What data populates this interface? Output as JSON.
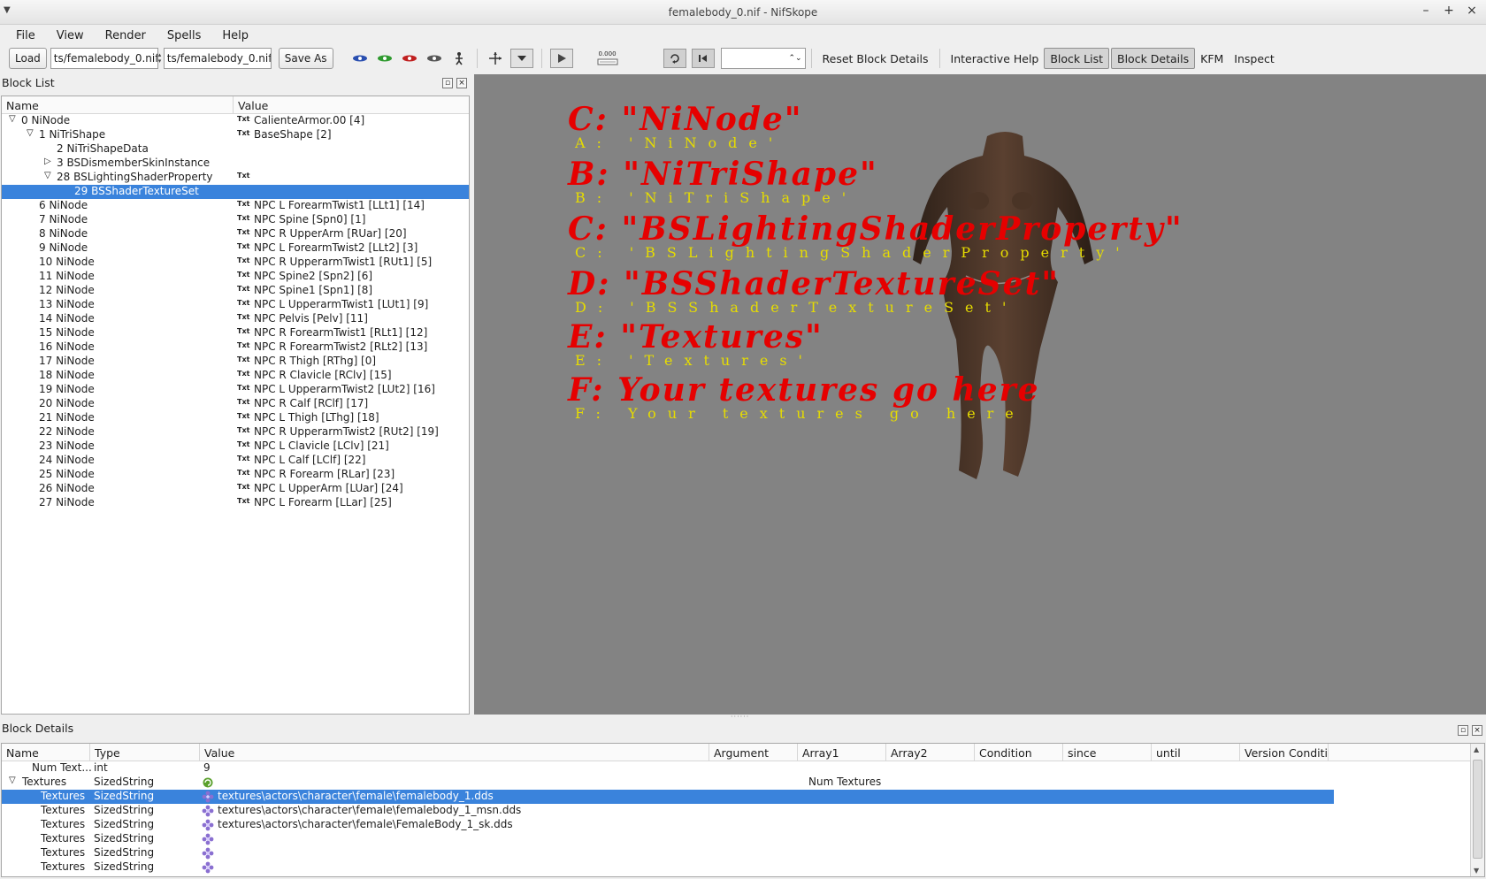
{
  "window": {
    "title": "femalebody_0.nif - NifSkope"
  },
  "menu": [
    {
      "label": "File"
    },
    {
      "label": "View"
    },
    {
      "label": "Render"
    },
    {
      "label": "Spells"
    },
    {
      "label": "Help"
    }
  ],
  "toolbar": {
    "load_label": "Load",
    "load_path": "ts/femalebody_0.nif",
    "save_path": "ts/femalebody_0.nif",
    "save_as_label": "Save As",
    "anim_time": "0.000",
    "reset_block_details": "Reset Block Details",
    "interactive_help": "Interactive Help",
    "block_list": "Block List",
    "block_details": "Block Details",
    "kfm": "KFM",
    "inspect": "Inspect"
  },
  "block_list": {
    "title": "Block List",
    "col_name": "Name",
    "col_value": "Value",
    "rows": [
      {
        "name": "0 NiNode",
        "value": "CalienteArmor.00 [4]",
        "depth": 0,
        "expand": "open",
        "txt": true
      },
      {
        "name": "1 NiTriShape",
        "value": "BaseShape [2]",
        "depth": 1,
        "expand": "open",
        "txt": true
      },
      {
        "name": "2 NiTriShapeData",
        "value": "",
        "depth": 2,
        "expand": "",
        "txt": false
      },
      {
        "name": "3 BSDismemberSkinInstance",
        "value": "",
        "depth": 2,
        "expand": "closed",
        "txt": false
      },
      {
        "name": "28 BSLightingShaderProperty",
        "value": "",
        "depth": 2,
        "expand": "open",
        "txt": true
      },
      {
        "name": "29 BSShaderTextureSet",
        "value": "",
        "depth": 3,
        "expand": "",
        "txt": false,
        "selected": true
      },
      {
        "name": "6 NiNode",
        "value": "NPC L ForearmTwist1 [LLt1] [14]",
        "depth": 1,
        "expand": "",
        "txt": true
      },
      {
        "name": "7 NiNode",
        "value": "NPC Spine [Spn0] [1]",
        "depth": 1,
        "expand": "",
        "txt": true
      },
      {
        "name": "8 NiNode",
        "value": "NPC R UpperArm [RUar] [20]",
        "depth": 1,
        "expand": "",
        "txt": true
      },
      {
        "name": "9 NiNode",
        "value": "NPC L ForearmTwist2 [LLt2] [3]",
        "depth": 1,
        "expand": "",
        "txt": true
      },
      {
        "name": "10 NiNode",
        "value": "NPC R UpperarmTwist1 [RUt1] [5]",
        "depth": 1,
        "expand": "",
        "txt": true
      },
      {
        "name": "11 NiNode",
        "value": "NPC Spine2 [Spn2] [6]",
        "depth": 1,
        "expand": "",
        "txt": true
      },
      {
        "name": "12 NiNode",
        "value": "NPC Spine1 [Spn1] [8]",
        "depth": 1,
        "expand": "",
        "txt": true
      },
      {
        "name": "13 NiNode",
        "value": "NPC L UpperarmTwist1 [LUt1] [9]",
        "depth": 1,
        "expand": "",
        "txt": true
      },
      {
        "name": "14 NiNode",
        "value": "NPC Pelvis [Pelv] [11]",
        "depth": 1,
        "expand": "",
        "txt": true
      },
      {
        "name": "15 NiNode",
        "value": "NPC R ForearmTwist1 [RLt1] [12]",
        "depth": 1,
        "expand": "",
        "txt": true
      },
      {
        "name": "16 NiNode",
        "value": "NPC R ForearmTwist2 [RLt2] [13]",
        "depth": 1,
        "expand": "",
        "txt": true
      },
      {
        "name": "17 NiNode",
        "value": "NPC R Thigh [RThg] [0]",
        "depth": 1,
        "expand": "",
        "txt": true
      },
      {
        "name": "18 NiNode",
        "value": "NPC R Clavicle [RClv] [15]",
        "depth": 1,
        "expand": "",
        "txt": true
      },
      {
        "name": "19 NiNode",
        "value": "NPC L UpperarmTwist2 [LUt2] [16]",
        "depth": 1,
        "expand": "",
        "txt": true
      },
      {
        "name": "20 NiNode",
        "value": "NPC R Calf [RClf] [17]",
        "depth": 1,
        "expand": "",
        "txt": true
      },
      {
        "name": "21 NiNode",
        "value": "NPC L Thigh [LThg] [18]",
        "depth": 1,
        "expand": "",
        "txt": true
      },
      {
        "name": "22 NiNode",
        "value": "NPC R UpperarmTwist2 [RUt2] [19]",
        "depth": 1,
        "expand": "",
        "txt": true
      },
      {
        "name": "23 NiNode",
        "value": "NPC L Clavicle [LClv] [21]",
        "depth": 1,
        "expand": "",
        "txt": true
      },
      {
        "name": "24 NiNode",
        "value": "NPC L Calf [LClf] [22]",
        "depth": 1,
        "expand": "",
        "txt": true
      },
      {
        "name": "25 NiNode",
        "value": "NPC R Forearm [RLar] [23]",
        "depth": 1,
        "expand": "",
        "txt": true
      },
      {
        "name": "26 NiNode",
        "value": "NPC L UpperArm [LUar] [24]",
        "depth": 1,
        "expand": "",
        "txt": true
      },
      {
        "name": "27 NiNode",
        "value": "NPC L Forearm [LLar] [25]",
        "depth": 1,
        "expand": "",
        "txt": true
      }
    ]
  },
  "viewport": {
    "lines": [
      {
        "glyph": "C: \"NiNode\"",
        "latin": "A:  'NiNode'"
      },
      {
        "glyph": "B: \"NiTriShape\"",
        "latin": "B:  'NiTriShape'"
      },
      {
        "glyph": "C: \"BSLightingShaderProperty\"",
        "latin": "C:  'BSLightingShaderProperty'"
      },
      {
        "glyph": "D: \"BSShaderTextureSet\"",
        "latin": "D:  'BSShaderTextureSet'"
      },
      {
        "glyph": "E: \"Textures\"",
        "latin": "E:  'Textures'"
      },
      {
        "glyph": "F: Your textures go here",
        "latin": "F:  Your textures go here"
      }
    ],
    "background": "#838383",
    "glyph_color": "#e60000",
    "latin_color": "#e6dc00"
  },
  "block_details": {
    "title": "Block Details",
    "columns": [
      "Name",
      "Type",
      "Value",
      "Argument",
      "Array1",
      "Array2",
      "Condition",
      "since",
      "until",
      "Version Conditi"
    ],
    "rows": [
      {
        "name": "Num Text...",
        "type": "int",
        "value": "9",
        "array1": "",
        "depth": 1,
        "expand": "",
        "icon": ""
      },
      {
        "name": "Textures",
        "type": "SizedString",
        "value": "",
        "array1": "Num Textures",
        "depth": 0,
        "expand": "open",
        "icon": "refresh"
      },
      {
        "name": "Textures",
        "type": "SizedString",
        "value": "textures\\actors\\character\\female\\femalebody_1.dds",
        "array1": "",
        "depth": 2,
        "expand": "",
        "icon": "flower",
        "selected": true
      },
      {
        "name": "Textures",
        "type": "SizedString",
        "value": "textures\\actors\\character\\female\\femalebody_1_msn.dds",
        "array1": "",
        "depth": 2,
        "expand": "",
        "icon": "flower"
      },
      {
        "name": "Textures",
        "type": "SizedString",
        "value": "textures\\actors\\character\\female\\FemaleBody_1_sk.dds",
        "array1": "",
        "depth": 2,
        "expand": "",
        "icon": "flower"
      },
      {
        "name": "Textures",
        "type": "SizedString",
        "value": "",
        "array1": "",
        "depth": 2,
        "expand": "",
        "icon": "flower"
      },
      {
        "name": "Textures",
        "type": "SizedString",
        "value": "",
        "array1": "",
        "depth": 2,
        "expand": "",
        "icon": "flower"
      },
      {
        "name": "Textures",
        "type": "SizedString",
        "value": "",
        "array1": "",
        "depth": 2,
        "expand": "",
        "icon": "flower"
      }
    ]
  }
}
